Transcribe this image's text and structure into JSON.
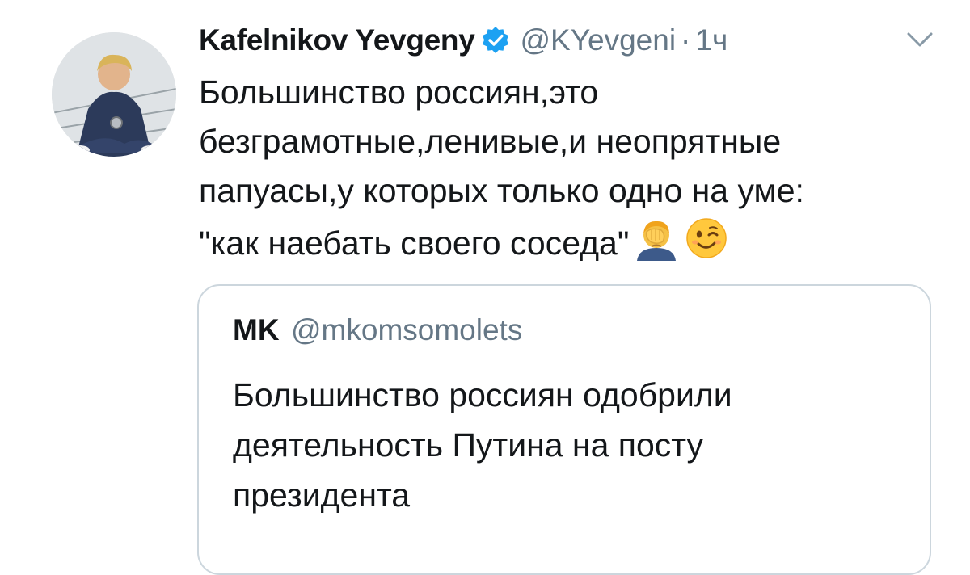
{
  "tweet": {
    "author_name": "Kafelnikov Yevgeny",
    "handle": "@KYevgeni",
    "separator": "·",
    "time": "1ч",
    "text_lines": [
      "Большинство россиян,это",
      "безграмотные,ленивые,и неопрятные",
      "папуасы,у которых только одно на уме:",
      "\"как наебать своего соседа\""
    ],
    "icons": {
      "verified": "verified-badge-icon",
      "menu": "chevron-down-icon",
      "emoji_1": "facepalm-emoji",
      "emoji_2": "winking-face-emoji"
    }
  },
  "quote": {
    "name": "MK",
    "handle": "@mkomsomolets",
    "text_lines": [
      "Большинство россиян одобрили",
      "деятельность Путина на посту",
      "президента"
    ]
  },
  "colors": {
    "text": "#14171a",
    "secondary": "#657786",
    "verified": "#1da1f2",
    "border": "#ccd6dd"
  }
}
